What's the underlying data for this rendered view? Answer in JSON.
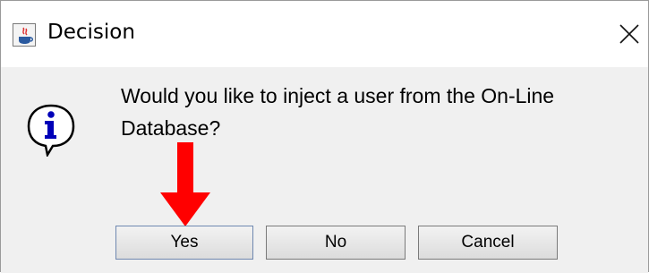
{
  "dialog": {
    "title": "Decision",
    "message": "Would you like to inject a user from the On-Line Database?",
    "icons": {
      "app": "java-coffee-icon",
      "info": "info-speech-bubble-icon",
      "close": "close-icon",
      "annotation": "red-down-arrow"
    }
  },
  "buttons": {
    "yes": "Yes",
    "no": "No",
    "cancel": "Cancel"
  },
  "colors": {
    "arrow": "#ff0000",
    "info_letter": "#0000b8"
  }
}
